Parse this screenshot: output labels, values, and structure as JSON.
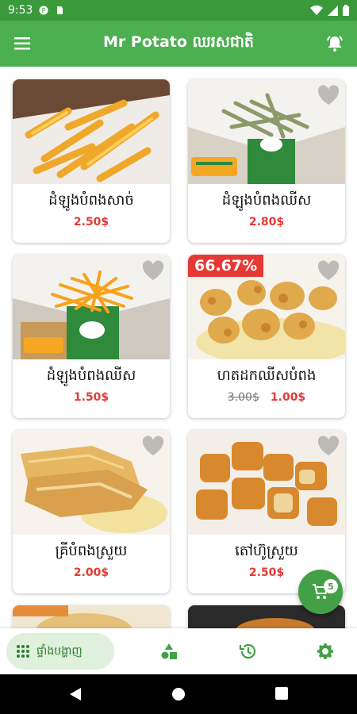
{
  "status_bar": {
    "time": "9:53"
  },
  "app_bar": {
    "title": "Mr Potato ឈរសជាតិ"
  },
  "products": [
    {
      "name": "ដំឡូងបំពងសាច់",
      "price": "2.50$"
    },
    {
      "name": "ដំឡូងបំពងឈីស",
      "price": "2.80$"
    },
    {
      "name": "ដំឡូងបំពងឈីស",
      "price": "1.50$"
    },
    {
      "name": "ហតដកឈីសបំពង",
      "old_price": "3.00$",
      "price": "1.00$",
      "discount": "66.67%"
    },
    {
      "name": "គ្រីបំពងស្រួយ",
      "price": "2.00$"
    },
    {
      "name": "តៅហ៊ូស្រួយ",
      "price": "2.50$"
    }
  ],
  "cart": {
    "count": "5"
  },
  "bottom_nav": {
    "active_label": "ផ្ទាំងបង្ហាញ"
  },
  "colors": {
    "primary": "#4caf50",
    "status_bar": "#3a9a3a",
    "price_red": "#e53935",
    "nav_active_bg": "#dff0dc"
  }
}
